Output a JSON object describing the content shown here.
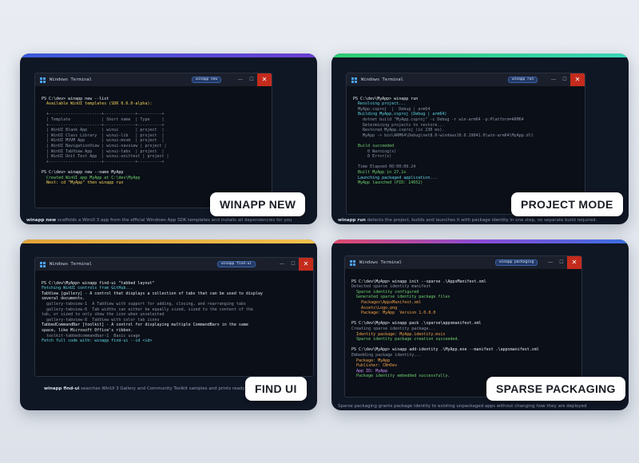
{
  "cards": [
    {
      "label": "WINAPP NEW",
      "terminal_title": "Windows Terminal",
      "tab_label": "winapp new",
      "caption_cmd": "winapp new",
      "caption_text": " scaffolds a WinUI 3 app from the official Windows App SDK templates and installs all dependencies for you",
      "lines": [
        "PS C:\\dev> winapp new --list",
        "  Available WinUI templates (SDK 0.6.0-alpha):",
        "",
        "  +----------------------+-------------+----------+",
        "  | Template             | Short name  | Type     |",
        "  +----------------------+-------------+----------+",
        "  | WinUI Blank App      | winui       | project  |",
        "  | WinUI Class Library  | winui-lib   | project  |",
        "  | WinUI MVVM App       | winui-mvvm  | project  |",
        "  | WinUI NavigationView | winui-navview | project |",
        "  | WinUI TabView App    | winui-tabs  | project  |",
        "  | WinUI Unit Test App  | winui-unittest | project |",
        "  +----------------------+-------------+----------+",
        "",
        "PS C:\\dev> winapp new --name MyApp",
        "  Created WinUI app MyApp at C:\\dev\\MyApp",
        "  Next: cd \"MyApp\" then winapp run"
      ]
    },
    {
      "label": "PROJECT MODE",
      "terminal_title": "Windows Terminal",
      "tab_label": "winapp run",
      "caption_cmd": "winapp run",
      "caption_text": " detects the project, builds and launches it with package identity in one step, no separate build required.",
      "lines": [
        "PS C:\\dev\\MyApp> winapp run",
        "  Resolving project...",
        "  MyApp.csproj  |  Debug | arm64",
        "  Building MyApp.csproj (Debug | arm64)",
        "    dotnet build \"MyApp.csproj\" -c Debug -r win-arm64 -p:Platform=ARM64",
        "    Determining projects to restore...",
        "    Restored MyApp.csproj (in 230 ms).",
        "    MyApp -> bin\\ARM64\\Debug\\net8.0-windows10.0.19041.0\\win-arm64\\MyApp.dll",
        "",
        "  Build succeeded",
        "      0 Warning(s)",
        "      0 Error(s)",
        "",
        "  Time Elapsed 00:00:09.24",
        "  Built MyApp in 27.1s",
        "  Launching packaged application...",
        "  MyApp launched (PID: 14652)"
      ]
    },
    {
      "label": "FIND UI",
      "terminal_title": "Windows Terminal",
      "tab_label": "winapp find-ui",
      "caption_cmd": "winapp find-ui",
      "caption_text": " searches WinUI 3 Gallery and Community Toolkit samples and prints ready-to-use code",
      "lines": [
        "PS C:\\dev\\MyApp> winapp find-ui \"tabbed layout\"",
        "Fetching WinUI controls from GitHub...",
        "TabView [gallery] - A control that displays a collection of tabs that can be used to display",
        "several documents.",
        "  gallery-tabview-1  A TabView with support for adding, closing, and rearranging tabs",
        "  gallery-tabview-6  Tab widths can either be equally sized, sized to the content of the",
        "tab, or sized to only show the icon when unselected",
        "  gallery-tabview-8  TabView with color tab icons",
        "TabbedCommandBar [toolkit] - A control for displaying multiple CommandBars in the same",
        "space, like Microsoft Office's ribbon.",
        "  toolkit-tabbedcommandbar-1  Basic usage",
        "Fetch full code with: winapp find-ui --id <id>"
      ]
    },
    {
      "label": "SPARSE PACKAGING",
      "terminal_title": "Windows Terminal",
      "tab_label": "winapp packaging",
      "caption_cmd": "",
      "caption_text": "Sparse packaging grants package identity to existing unpackaged apps without changing how they are deployed",
      "lines": [
        "PS C:\\dev\\MyApp> winapp init --sparse .\\AppxManifest.xml",
        "Detected sparse identity manifest",
        "  Sparse identity configured",
        "  Generated sparse identity package files",
        "    Packages\\AppxManifest.xml",
        "    Assets\\Logo.png",
        "    Package: MyApp  Version 1.0.0.0",
        "",
        "PS C:\\dev\\MyApp> winapp pack .\\sparse\\appxmanifest.xml",
        "Creating sparse identity package...",
        "  Identity package: MyApp.identity.msix",
        "  Sparse identity package creation succeeded.",
        "",
        "PS C:\\dev\\MyApp> winapp add-identity .\\MyApp.exe --manifest .\\appxmanifest.xml",
        "Embedding package identity...",
        "  Package: MyApp",
        "  Publisher: CN=Dev",
        "  App ID: MyApp",
        "  Package identity embedded successfully."
      ]
    }
  ],
  "colors": {
    "card1_bar": [
      "#3a5bd9",
      "#6a3fd1"
    ],
    "card2_bar": [
      "#2ecc71",
      "#38d6b8"
    ],
    "card3_bar": [
      "#e0a33a",
      "#f2c14e"
    ],
    "card4_bar": [
      "#e04a6a",
      "#8a4bd6",
      "#3a6fe0"
    ]
  }
}
